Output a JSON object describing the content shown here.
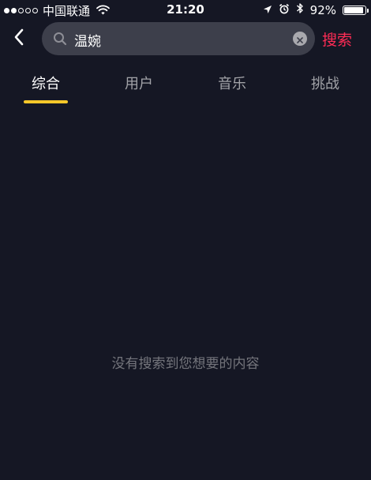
{
  "status_bar": {
    "carrier": "中国联通",
    "time": "21:20",
    "battery_text": "92%",
    "battery_level": 0.92,
    "signal_bars_filled": 2,
    "signal_bars_total": 5
  },
  "search": {
    "query": "温婉",
    "submit_label": "搜索"
  },
  "tabs": [
    {
      "label": "综合",
      "active": true
    },
    {
      "label": "用户",
      "active": false
    },
    {
      "label": "音乐",
      "active": false
    },
    {
      "label": "挑战",
      "active": false
    }
  ],
  "empty_state": {
    "message": "没有搜索到您想要的内容"
  },
  "colors": {
    "background": "#151724",
    "search_box": "#3d3f4b",
    "accent_red": "#fe2c55",
    "tab_indicator": "#f7c82a",
    "muted_text": "#74757c"
  },
  "icons": [
    "back-chevron-icon",
    "search-icon",
    "clear-icon",
    "wifi-icon",
    "location-arrow-icon",
    "alarm-clock-icon",
    "bluetooth-icon",
    "battery-icon"
  ]
}
